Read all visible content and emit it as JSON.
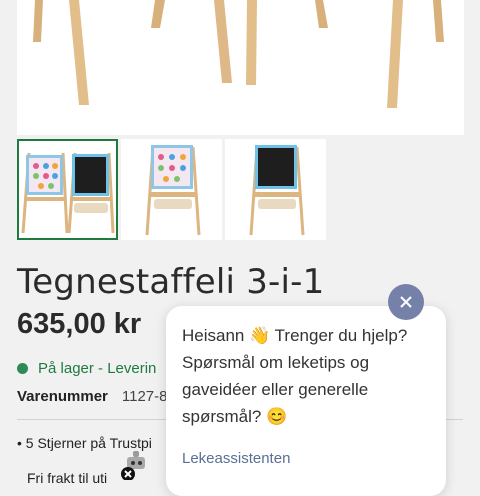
{
  "product": {
    "title": "Tegnestaffeli 3-i-1",
    "price": "635,00 kr",
    "stock_text": "På lager - Leverin",
    "sku_label": "Varenummer",
    "sku_value": "1127-8",
    "bullets": [
      "• 5 Stjerner på Trustpi",
      "Fri frakt til uti"
    ]
  },
  "gallery": {
    "thumbnails": [
      "easel-front",
      "easel-whiteboard-side",
      "easel-chalkboard-side"
    ],
    "active_index": 0
  },
  "chat": {
    "message": "Heisann 👋 Trenger du hjelp? Spørsmål om leketips og gaveidéer eller generelle spørsmål? 😊",
    "sender": "Lekeassistenten"
  },
  "colors": {
    "accent_green": "#1f7a3f",
    "close_button": "#7681a9",
    "chat_sender": "#5a6f94"
  }
}
